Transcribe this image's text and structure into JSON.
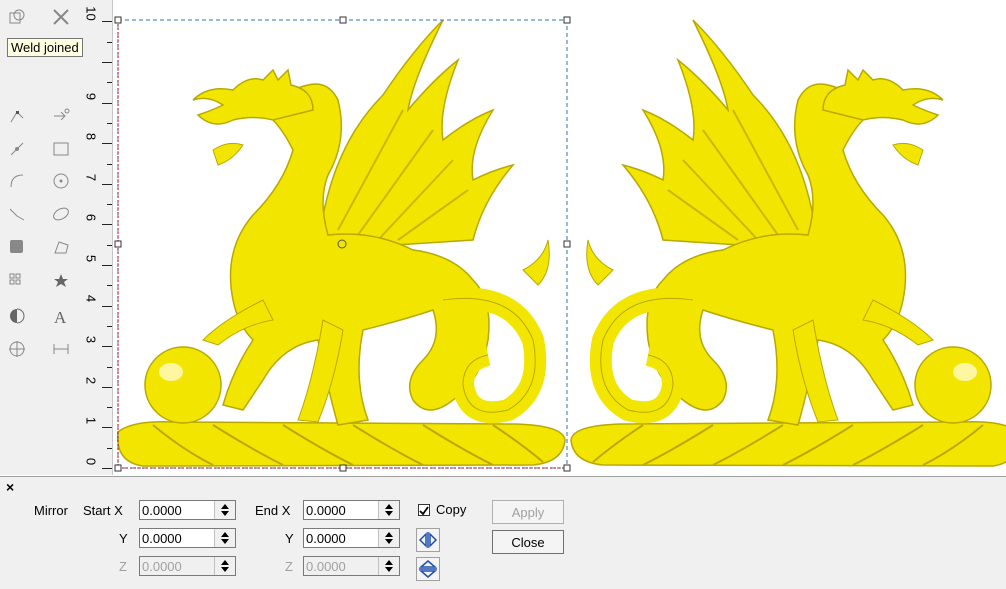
{
  "tooltip": {
    "text": "Weld joined"
  },
  "ruler": {
    "labels": [
      "0",
      "1",
      "2",
      "3",
      "4",
      "5",
      "6",
      "7",
      "8",
      "9",
      "10"
    ]
  },
  "panel": {
    "title": "Mirror",
    "start_x_label": "Start X",
    "end_x_label": "End X",
    "y_label": "Y",
    "z_label": "Z",
    "start_x": "0.0000",
    "start_y": "0.0000",
    "start_z": "0.0000",
    "end_x": "0.0000",
    "end_y": "0.0000",
    "end_z": "0.0000",
    "copy_label": "Copy",
    "copy_checked": true,
    "apply_label": "Apply",
    "close_label": "Close",
    "close_x": "×"
  },
  "colors": {
    "dragon": "#f2e600",
    "dragon_shadow": "#b8a800",
    "selection": "#c00000"
  },
  "icons": [
    "weld-icon",
    "trim-icon",
    "node-edit-icon",
    "transform-icon",
    "point-edit-icon",
    "rectangle-icon",
    "polyline-icon",
    "circle-icon",
    "bezier-icon",
    "ellipse-icon",
    "arc-icon",
    "polygon-icon",
    "fill-icon",
    "star-icon",
    "array-icon",
    "text-icon",
    "mirror-icon",
    "dimension-icon"
  ]
}
